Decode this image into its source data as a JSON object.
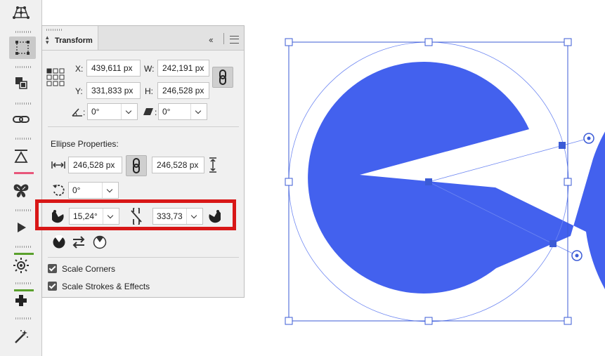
{
  "toolbar": {
    "tools": [
      {
        "name": "mesh-warp-tool",
        "icon": "mesh-icon"
      },
      {
        "name": "transform-tool",
        "icon": "transform-icon",
        "active": true
      },
      {
        "name": "arrange-tool",
        "icon": "arrange-icon"
      },
      {
        "name": "link-tool",
        "icon": "chain-link-icon"
      },
      {
        "name": "align-tool",
        "icon": "align-triangle-icon"
      },
      {
        "name": "symmetry-tool",
        "icon": "butterfly-icon"
      },
      {
        "name": "play-tool",
        "icon": "play-icon"
      },
      {
        "name": "brightness-tool",
        "icon": "sun-icon"
      },
      {
        "name": "add-tool",
        "icon": "plus-icon"
      },
      {
        "name": "magic-wand-tool",
        "icon": "magic-wand-icon"
      }
    ],
    "accent_colors": [
      "#e8567a",
      "#5aa02c"
    ]
  },
  "panel": {
    "title": "Transform",
    "x_label": "X:",
    "x_value": "439,611 px",
    "y_label": "Y:",
    "y_value": "331,833 px",
    "w_label": "W:",
    "w_value": "242,191 px",
    "h_label": "H:",
    "h_value": "246,528 px",
    "rotate_value": "0°",
    "skew_value": "0°",
    "ellipse_title": "Ellipse Properties:",
    "ellipse_width": "246,528 px",
    "ellipse_height": "246,528 px",
    "ellipse_rotation": "0°",
    "start_angle": "15,24°",
    "end_angle": "333,73",
    "scale_corners_label": "Scale Corners",
    "scale_corners_checked": true,
    "scale_strokes_label": "Scale Strokes & Effects",
    "scale_strokes_checked": true
  },
  "canvas": {
    "shape": "ellipse-pie",
    "fill_color": "#4361ee",
    "selection_color": "#3b5bd6",
    "highlight_color": "#d81717"
  }
}
